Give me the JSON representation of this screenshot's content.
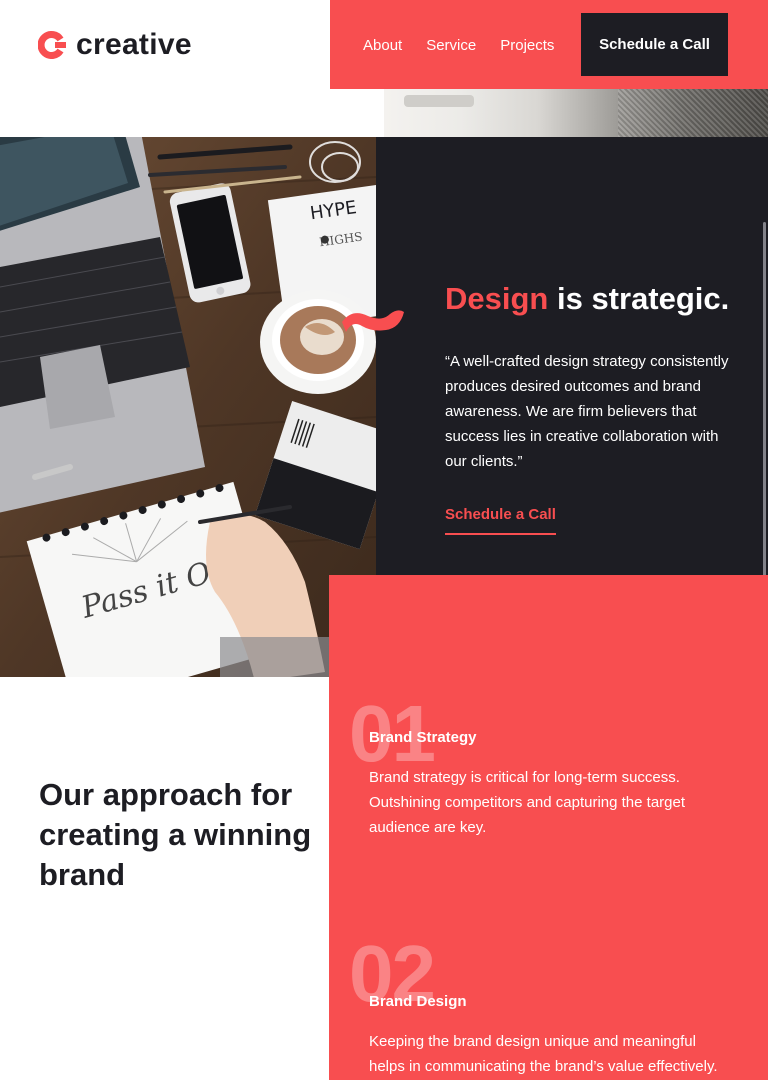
{
  "brand": {
    "name": "creative",
    "accent": "#f84e50",
    "dark": "#1d1d23"
  },
  "nav": {
    "items": [
      {
        "label": "About"
      },
      {
        "label": "Service"
      },
      {
        "label": "Projects"
      }
    ],
    "cta_label": "Schedule a Call"
  },
  "hero": {
    "headline_accent": "Design",
    "headline_rest": " is strategic.",
    "quote": "“A well-crafted design strategy consistently produces desired outcomes and brand awareness. We are firm believers that success lies in creative collaboration with our clients.”",
    "cta_label": "Schedule a Call"
  },
  "approach": {
    "title": "Our approach for creating a winning brand",
    "steps": [
      {
        "number": "01",
        "title": "Brand Strategy",
        "text": "Brand strategy is critical for long-term success. Outshining competitors and capturing the target audience are key."
      },
      {
        "number": "02",
        "title": "Brand Design",
        "text": "Keeping the brand design unique and meaningful helps in communicating the brand’s value effectively."
      }
    ]
  },
  "icons": [
    "logo-mark-icon",
    "swoosh-icon"
  ]
}
